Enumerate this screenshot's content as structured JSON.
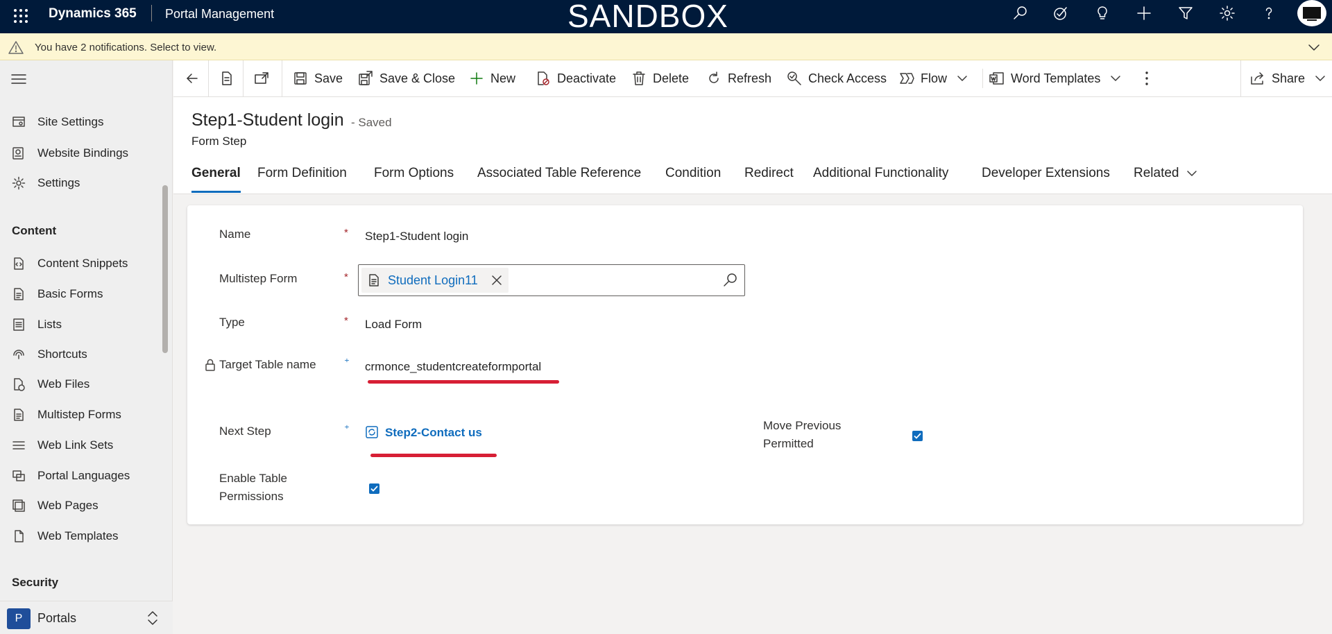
{
  "topbar": {
    "app_name": "Dynamics 365",
    "area_name": "Portal Management",
    "environment": "SANDBOX",
    "icons": [
      "search-icon",
      "task-icon",
      "lightbulb-icon",
      "plus-icon",
      "filter-icon",
      "gear-icon",
      "help-icon",
      "avatar"
    ]
  },
  "notification": {
    "text": "You have 2 notifications. Select to view."
  },
  "sidebar": {
    "items_top": [
      {
        "label": "Site Settings",
        "icon": "site-settings-icon"
      },
      {
        "label": "Website Bindings",
        "icon": "website-bindings-icon"
      },
      {
        "label": "Settings",
        "icon": "gear-icon"
      }
    ],
    "group_content": "Content",
    "items_content": [
      {
        "label": "Content Snippets",
        "icon": "content-snippet-icon"
      },
      {
        "label": "Basic Forms",
        "icon": "form-icon"
      },
      {
        "label": "Lists",
        "icon": "list-icon"
      },
      {
        "label": "Shortcuts",
        "icon": "shortcut-icon"
      },
      {
        "label": "Web Files",
        "icon": "web-file-icon"
      },
      {
        "label": "Multistep Forms",
        "icon": "form-icon"
      },
      {
        "label": "Web Link Sets",
        "icon": "list-icon"
      },
      {
        "label": "Portal Languages",
        "icon": "language-icon"
      },
      {
        "label": "Web Pages",
        "icon": "web-page-icon"
      },
      {
        "label": "Web Templates",
        "icon": "document-icon"
      }
    ],
    "group_security": "Security",
    "area_switcher": {
      "badge": "P",
      "label": "Portals"
    }
  },
  "commands": {
    "save": "Save",
    "save_close": "Save & Close",
    "new": "New",
    "deactivate": "Deactivate",
    "delete": "Delete",
    "refresh": "Refresh",
    "check_access": "Check Access",
    "flow": "Flow",
    "word_templates": "Word Templates",
    "share": "Share"
  },
  "record": {
    "title": "Step1-Student login",
    "status": "- Saved",
    "entity": "Form Step"
  },
  "tabs": [
    "General",
    "Form Definition",
    "Form Options",
    "Associated Table Reference",
    "Condition",
    "Redirect",
    "Additional Functionality",
    "Developer Extensions",
    "Related"
  ],
  "form": {
    "name_label": "Name",
    "name_value": "Step1-Student login",
    "multistep_label": "Multistep Form",
    "multistep_value": "Student Login11",
    "type_label": "Type",
    "type_value": "Load Form",
    "target_label": "Target Table name",
    "target_value": "crmonce_studentcreateformportal",
    "next_label": "Next Step",
    "next_value": "Step2-Contact us",
    "move_prev_label_1": "Move Previous",
    "move_prev_label_2": "Permitted",
    "move_prev_checked": true,
    "enable_perm_label_1": "Enable Table",
    "enable_perm_label_2": "Permissions",
    "enable_perm_checked": true,
    "required_marker": "*",
    "recommended_marker": "⁺"
  },
  "colors": {
    "topbar": "#001a3a",
    "notification": "#fdf6d3",
    "accent": "#0f6cbd",
    "required": "#a4262c",
    "annotation": "#d71f35"
  }
}
